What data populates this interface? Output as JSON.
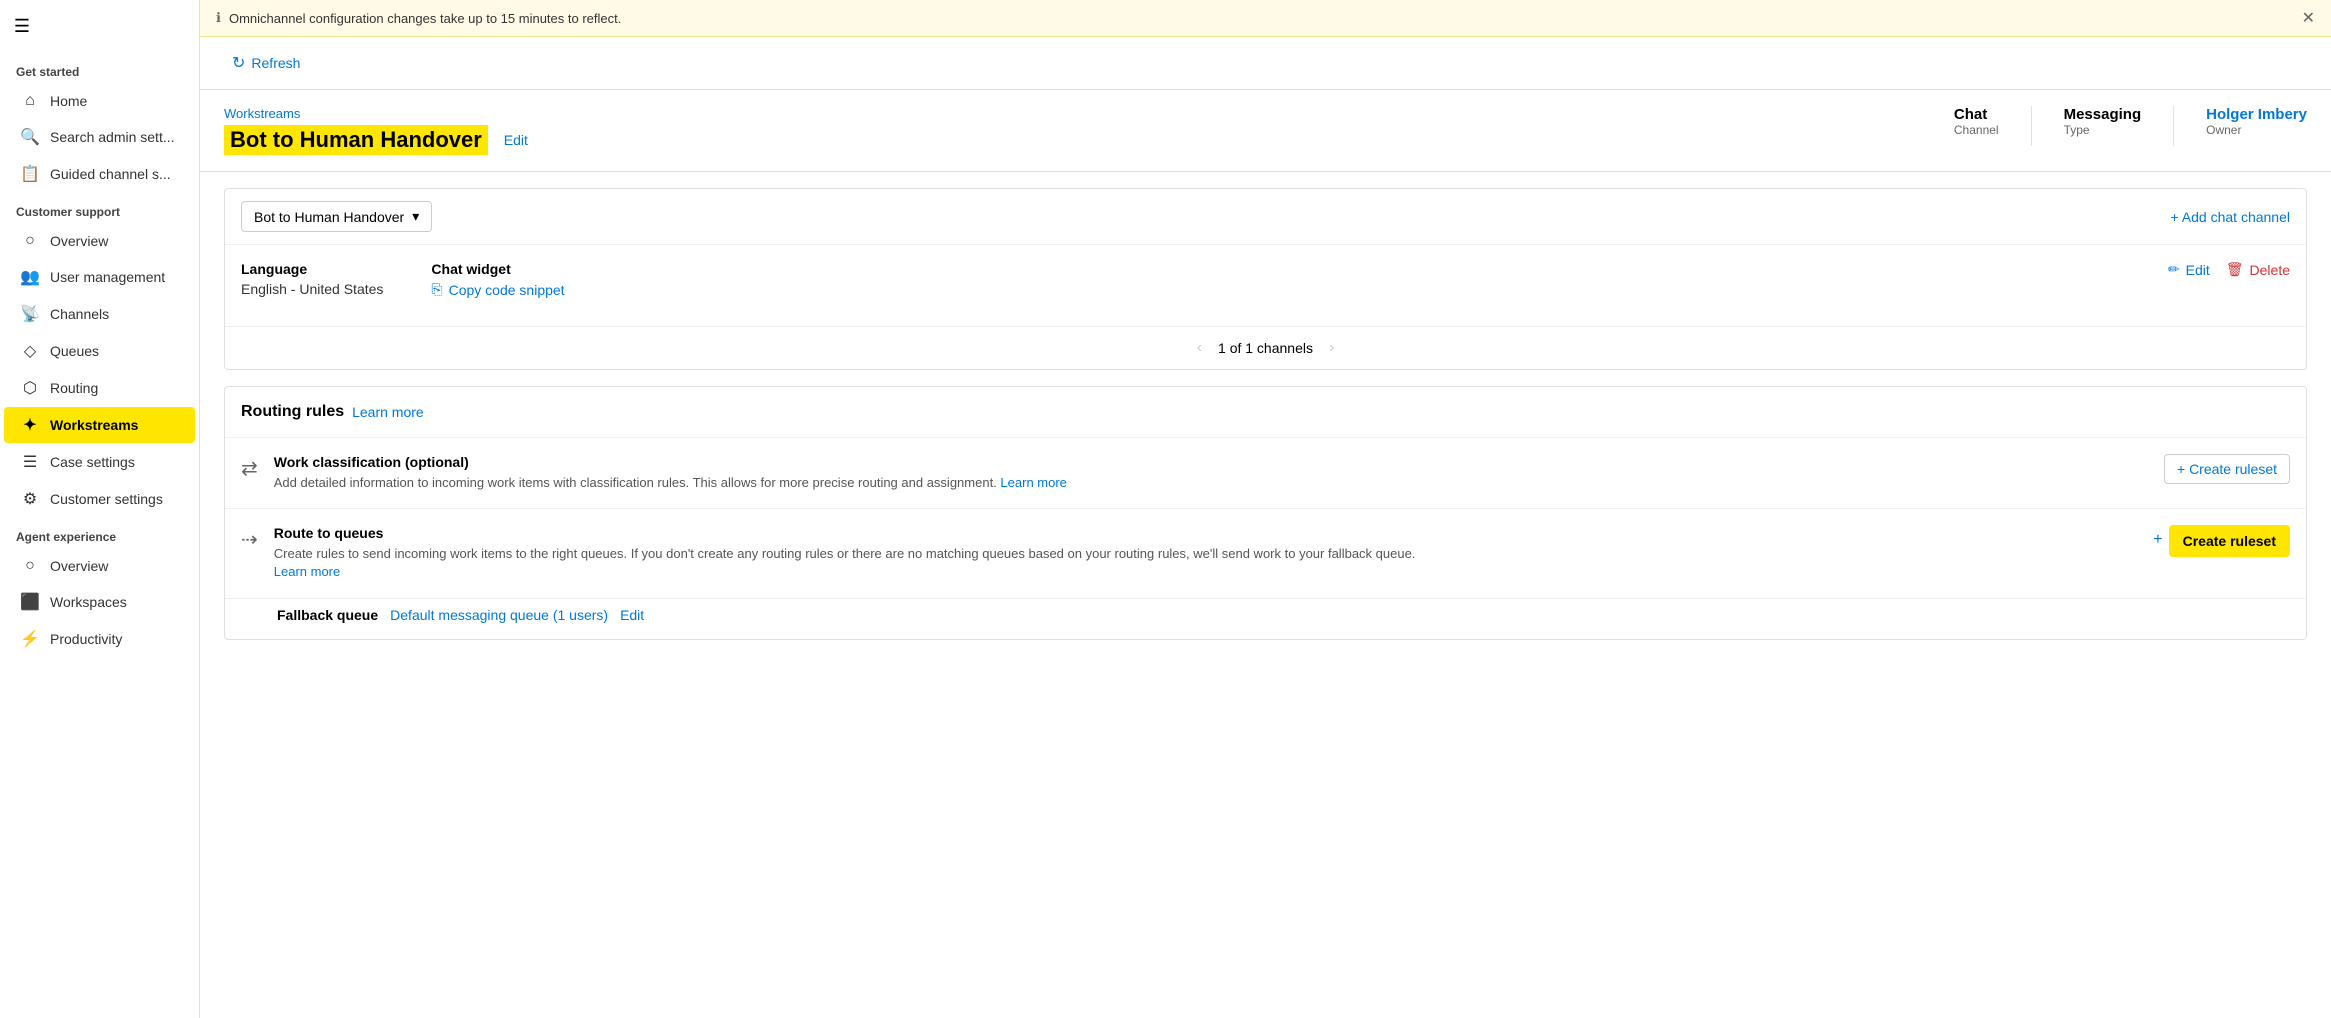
{
  "sidebar": {
    "hamburger_label": "☰",
    "get_started_label": "Get started",
    "items_top": [
      {
        "id": "home",
        "label": "Home",
        "icon": "⌂"
      },
      {
        "id": "search",
        "label": "Search admin sett...",
        "icon": "🔍"
      },
      {
        "id": "guided",
        "label": "Guided channel s...",
        "icon": "📋"
      }
    ],
    "customer_support_label": "Customer support",
    "items_cs": [
      {
        "id": "overview",
        "label": "Overview",
        "icon": "○"
      },
      {
        "id": "user-mgmt",
        "label": "User management",
        "icon": "👥"
      },
      {
        "id": "channels",
        "label": "Channels",
        "icon": "📡"
      },
      {
        "id": "queues",
        "label": "Queues",
        "icon": "◇"
      },
      {
        "id": "routing",
        "label": "Routing",
        "icon": "⬡"
      },
      {
        "id": "workstreams",
        "label": "Workstreams",
        "icon": "✦",
        "active": true
      },
      {
        "id": "case-settings",
        "label": "Case settings",
        "icon": "☰"
      },
      {
        "id": "customer-settings",
        "label": "Customer settings",
        "icon": "⚙"
      }
    ],
    "agent_experience_label": "Agent experience",
    "items_ae": [
      {
        "id": "ae-overview",
        "label": "Overview",
        "icon": "○"
      },
      {
        "id": "workspaces",
        "label": "Workspaces",
        "icon": "⬛"
      },
      {
        "id": "productivity",
        "label": "Productivity",
        "icon": "⚡"
      }
    ]
  },
  "banner": {
    "message": "Omnichannel configuration changes take up to 15 minutes to reflect.",
    "close_label": "✕"
  },
  "toolbar": {
    "refresh_label": "Refresh",
    "refresh_icon": "↻"
  },
  "page_header": {
    "breadcrumb": "Workstreams",
    "title": "Bot to Human Handover",
    "edit_label": "Edit",
    "channel_label": "Chat",
    "channel_sublabel": "Channel",
    "type_label": "Messaging",
    "type_sublabel": "Type",
    "owner_label": "Holger Imbery",
    "owner_sublabel": "Owner"
  },
  "channel_section": {
    "dropdown_value": "Bot to Human Handover",
    "add_channel_label": "+ Add chat channel",
    "language_label": "Language",
    "language_value": "English - United States",
    "chat_widget_label": "Chat widget",
    "copy_snippet_label": "Copy code snippet",
    "edit_label": "Edit",
    "delete_label": "Delete",
    "pagination_text": "1 of 1 channels",
    "prev_icon": "‹",
    "next_icon": "›"
  },
  "routing_rules": {
    "title": "Routing rules",
    "learn_more_label": "Learn more",
    "work_classification": {
      "title": "Work classification (optional)",
      "description": "Add detailed information to incoming work items with classification rules. This allows for more precise routing and assignment.",
      "learn_more_label": "Learn more",
      "create_label": "+ Create ruleset"
    },
    "route_to_queues": {
      "title": "Route to queues",
      "description": "Create rules to send incoming work items to the right queues. If you don't create any routing rules or there are no matching queues based on your routing rules, we'll send work to your fallback queue.",
      "learn_more_label": "Learn more",
      "create_label": "Create ruleset",
      "plus_icon": "+"
    },
    "fallback_queue": {
      "label": "Fallback queue",
      "queue_link": "Default messaging queue (1 users)",
      "edit_label": "Edit"
    }
  }
}
